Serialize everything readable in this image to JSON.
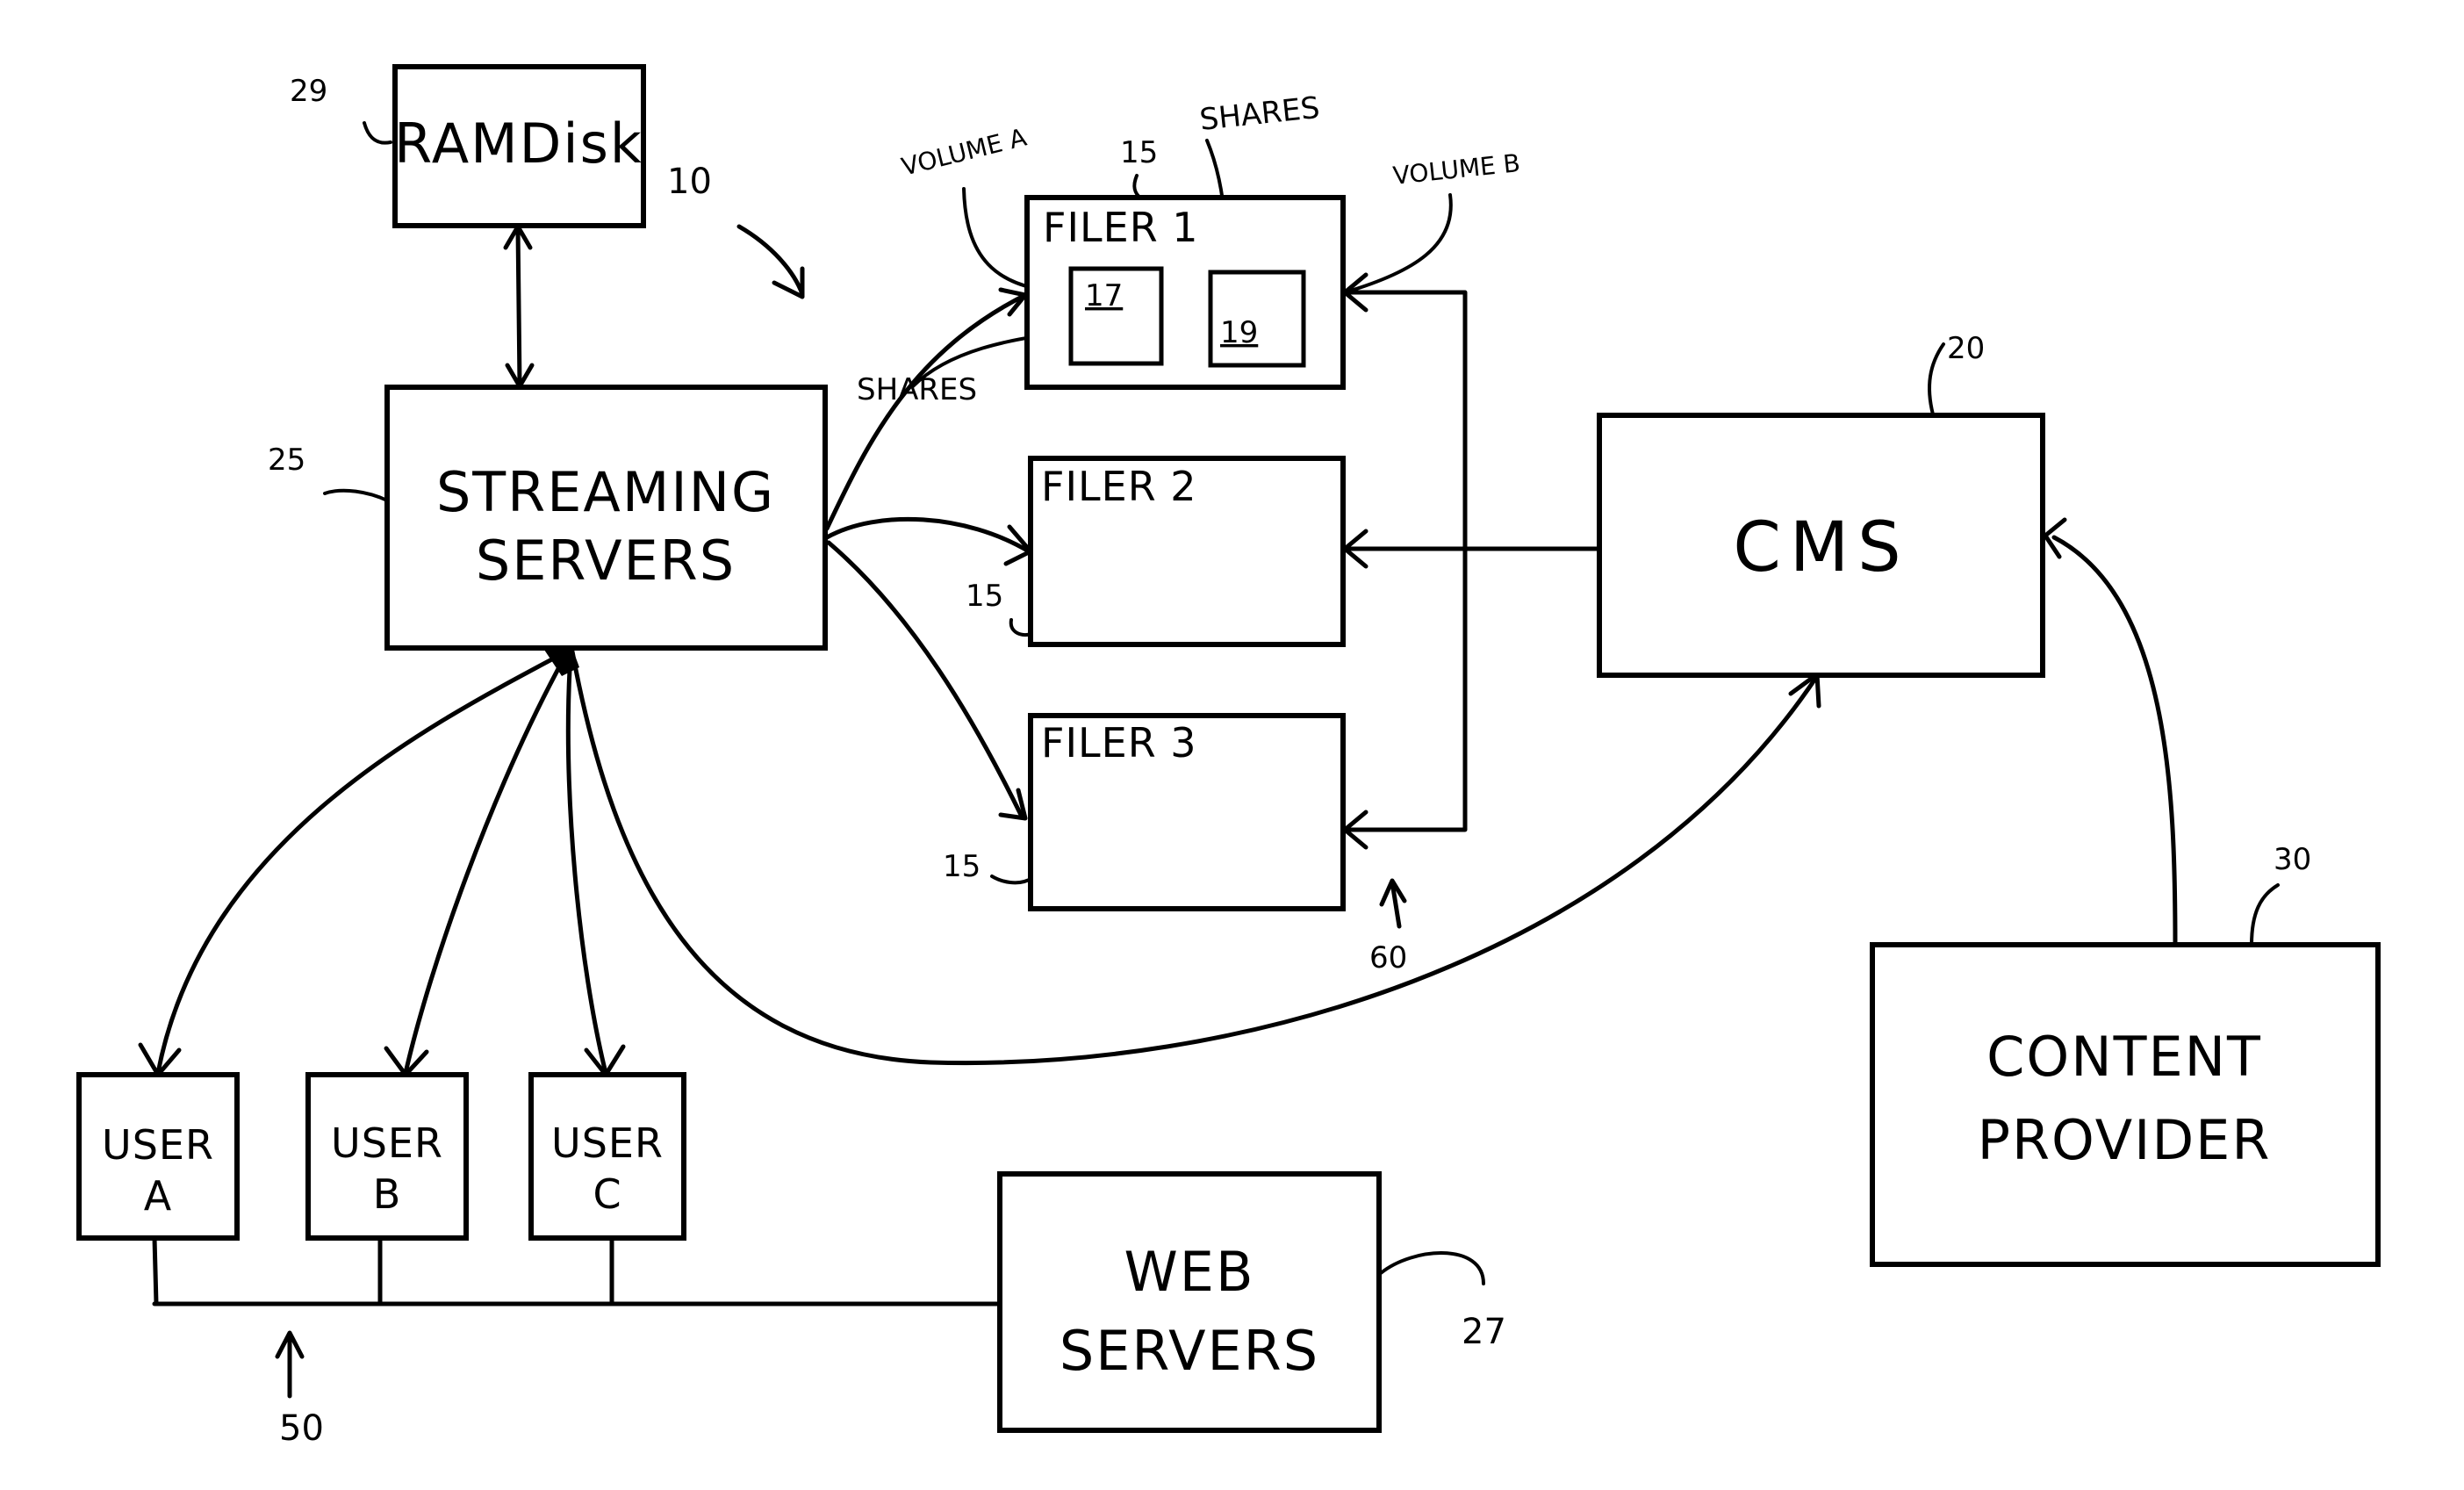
{
  "figure": {
    "ref_system": "10",
    "components": {
      "ramdisk": {
        "label": "RAMDisk",
        "ref": "29"
      },
      "streaming": {
        "label_line1": "STREAMING",
        "label_line2": "SERVERS",
        "ref": "25"
      },
      "filer1": {
        "label": "FILER 1",
        "ref": "15",
        "volume_a_ref": "17",
        "volume_b_ref": "19"
      },
      "filer2": {
        "label": "FILER 2",
        "ref": "15"
      },
      "filer3": {
        "label": "FILER 3",
        "ref": "15"
      },
      "cms": {
        "label": "CMS",
        "ref": "20"
      },
      "content_provider": {
        "label_line1": "CONTENT",
        "label_line2": "PROVIDER",
        "ref": "30"
      },
      "user_a": {
        "label_line1": "USER",
        "label_line2": "A"
      },
      "user_b": {
        "label_line1": "USER",
        "label_line2": "B"
      },
      "user_c": {
        "label_line1": "USER",
        "label_line2": "C"
      },
      "web_servers": {
        "label_line1": "WEB",
        "label_line2": "SERVERS",
        "ref": "27"
      }
    },
    "annotations": {
      "volume_a": "VOLUME A",
      "volume_b": "VOLUME B",
      "shares_top": "SHARES",
      "shares_left": "SHARES",
      "network_ref": "50",
      "filer_link_ref": "60"
    }
  }
}
